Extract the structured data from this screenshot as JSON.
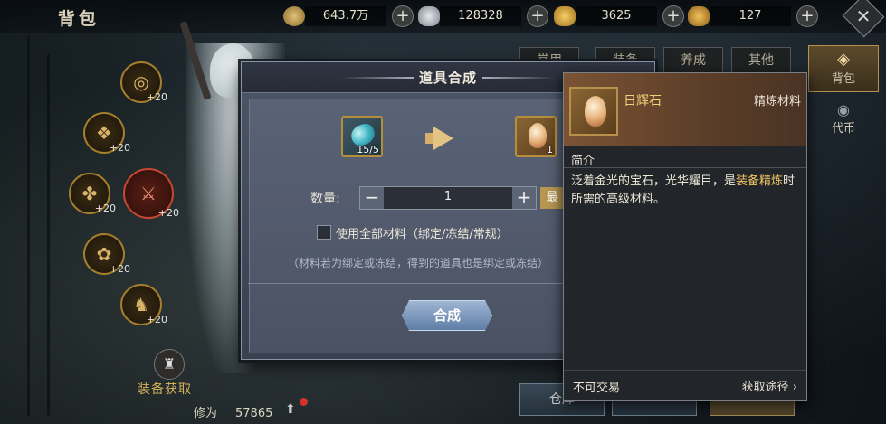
{
  "header": {
    "title": "背包",
    "currencies": [
      {
        "icon": "coin-icon",
        "value": "643.7万"
      },
      {
        "icon": "silver-ingot-icon",
        "value": "128328"
      },
      {
        "icon": "gold-ingot-icon",
        "value": "3625"
      },
      {
        "icon": "bound-gold-ingot-icon",
        "value": "127"
      }
    ],
    "plus": "+"
  },
  "character": {
    "equip_slots": [
      {
        "icon": "ring-icon",
        "level": "+20"
      },
      {
        "icon": "belt-icon",
        "level": "+20"
      },
      {
        "icon": "pendant-icon",
        "level": "+20"
      },
      {
        "icon": "weapon-icon",
        "level": "+20"
      },
      {
        "icon": "charm-icon",
        "level": "+20"
      },
      {
        "icon": "token-icon",
        "level": "+20"
      }
    ],
    "equip_get": "装备获取",
    "cultivation_label": "修为",
    "cultivation_value": "57865"
  },
  "tabs": [
    "常用",
    "装备",
    "养成",
    "其他"
  ],
  "side_tabs": [
    "背包",
    "代币"
  ],
  "bottom_buttons": [
    "仓库"
  ],
  "dialog": {
    "title": "道具合成",
    "material_count": "15/5",
    "result_count": "1",
    "qty_label": "数量:",
    "qty_value": "1",
    "minus": "−",
    "plus": "+",
    "max_label": "最",
    "checkbox_label": "使用全部材料（绑定/冻结/常规）",
    "note": "（材料若为绑定或冻结，得到的道具也是绑定或冻结）",
    "synth_button": "合成"
  },
  "tooltip": {
    "name": "日辉石",
    "type": "精炼材料",
    "section": "简介",
    "desc_1": "泛着金光的宝石，光华耀目，是",
    "desc_hl": "装备精炼",
    "desc_2": "时所需的高级材料。",
    "tradable": "不可交易",
    "source": "获取途径 ›"
  },
  "colors": {
    "gold_text": "#f3d27a",
    "highlight": "#f2c462",
    "button_blue": "#7f9bc0",
    "slot_border": "#a57f2c"
  }
}
